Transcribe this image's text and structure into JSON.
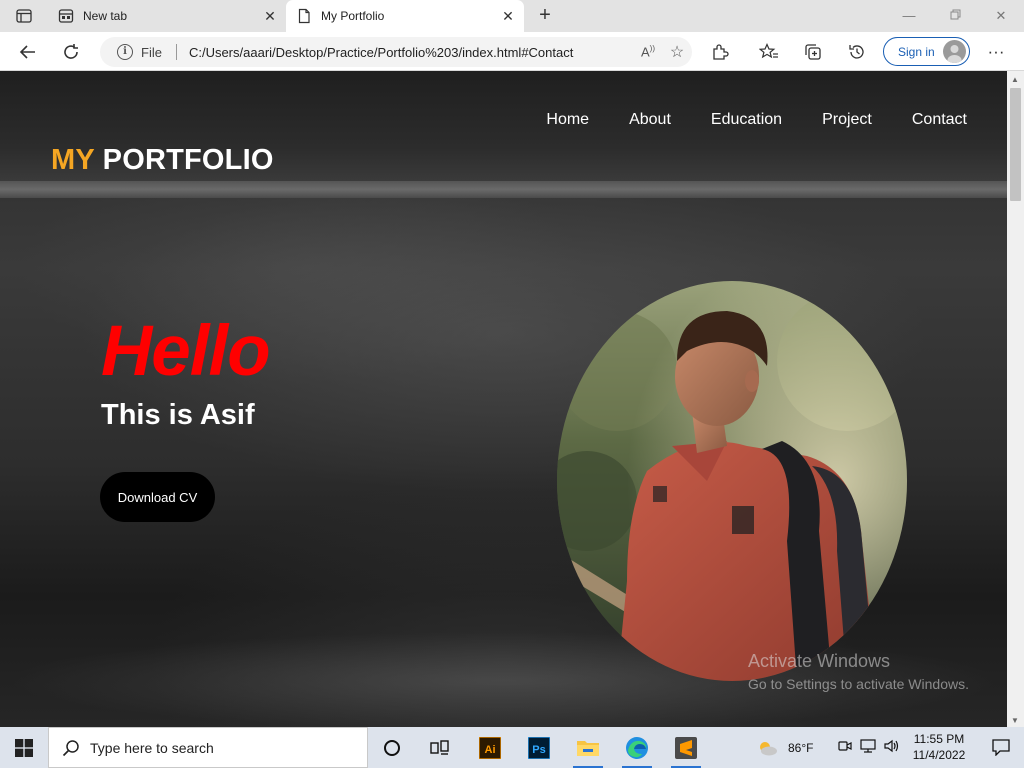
{
  "browser": {
    "tabs": [
      {
        "title": "New tab",
        "active": false
      },
      {
        "title": "My Portfolio",
        "active": true
      }
    ],
    "address": {
      "scheme_label": "File",
      "url": "C:/Users/aaari/Desktop/Practice/Portfolio%203/index.html#Contact"
    },
    "signin_label": "Sign in"
  },
  "page": {
    "logo": {
      "accent": "MY",
      "rest": "PORTFOLIO"
    },
    "nav": [
      "Home",
      "About",
      "Education",
      "Project",
      "Contact"
    ],
    "hero": {
      "greeting": "Hello",
      "intro": "This is Asif",
      "cta": "Download CV"
    },
    "watermark": {
      "line1": "Activate Windows",
      "line2": "Go to Settings to activate Windows."
    }
  },
  "taskbar": {
    "search_placeholder": "Type here to search",
    "apps": [
      "cortana-icon",
      "task-view-icon",
      "illustrator-icon",
      "photoshop-icon",
      "file-explorer-icon",
      "edge-icon",
      "sublime-text-icon"
    ],
    "weather": "86°F",
    "time": "11:55 PM",
    "date": "11/4/2022"
  },
  "colors": {
    "logo_accent": "#f5a623",
    "greeting": "#ff0000",
    "cta_bg": "#000000",
    "signin": "#1a5fb4"
  }
}
